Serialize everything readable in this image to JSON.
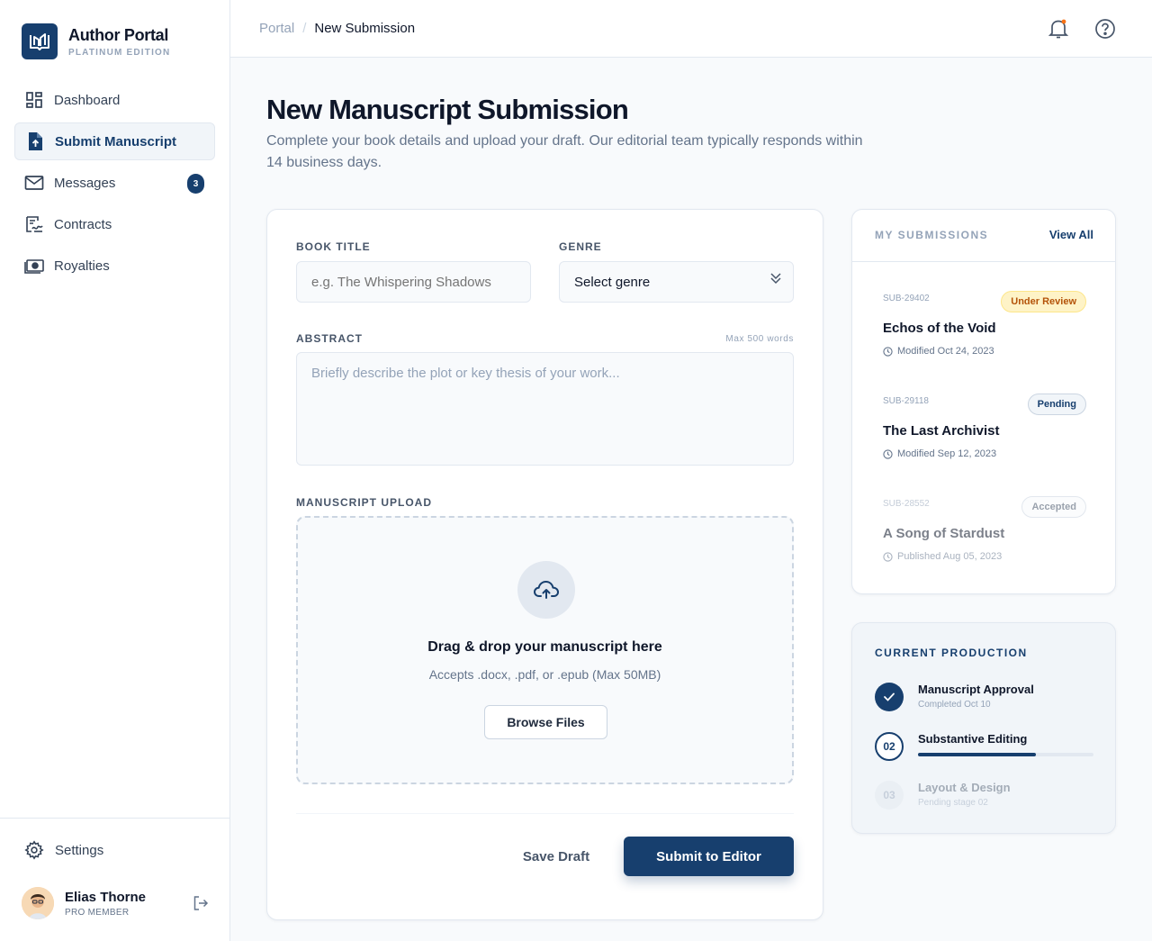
{
  "brand": {
    "title": "Author Portal",
    "subtitle": "PLATINUM EDITION",
    "icon": "open-book-icon"
  },
  "nav": {
    "items": [
      {
        "label": "Dashboard",
        "icon": "grid-icon"
      },
      {
        "label": "Submit Manuscript",
        "icon": "file-upload-icon",
        "active": true
      },
      {
        "label": "Messages",
        "icon": "mail-icon",
        "badge": "3"
      },
      {
        "label": "Contracts",
        "icon": "signature-icon"
      },
      {
        "label": "Royalties",
        "icon": "money-icon"
      }
    ]
  },
  "settings": {
    "label": "Settings",
    "icon": "gear-icon"
  },
  "user": {
    "name": "Elias Thorne",
    "role": "PRO MEMBER"
  },
  "breadcrumb": {
    "root": "Portal",
    "separator": "/",
    "current": "New Submission"
  },
  "header": {
    "title": "New Manuscript Submission",
    "description": "Complete your book details and upload your draft. Our editorial team typically responds within 14 business days."
  },
  "form": {
    "book_title_label": "BOOK TITLE",
    "book_title_placeholder": "e.g. The Whispering Shadows",
    "genre_label": "GENRE",
    "genre_value": "Select genre",
    "abstract_label": "ABSTRACT",
    "abstract_hint": "Max 500 words",
    "abstract_placeholder": "Briefly describe the plot or key thesis of your work...",
    "upload_label": "MANUSCRIPT UPLOAD",
    "upload_title": "Drag & drop your manuscript here",
    "upload_sub": "Accepts .docx, .pdf, or .epub (Max 50MB)",
    "browse_label": "Browse Files",
    "save_draft_label": "Save Draft",
    "submit_label": "Submit to Editor"
  },
  "submissions": {
    "title": "MY SUBMISSIONS",
    "view_all": "View All",
    "items": [
      {
        "id": "SUB-29402",
        "name": "Echos of the Void",
        "meta": "Modified Oct 24, 2023",
        "status": "Under Review",
        "status_color": "#b45309",
        "status_bg": "#fef3c7",
        "status_border": "#fde68a"
      },
      {
        "id": "SUB-29118",
        "name": "The Last Archivist",
        "meta": "Modified Sep 12, 2023",
        "status": "Pending",
        "status_color": "#173f6e",
        "status_bg": "#f1f5f9",
        "status_border": "#cbd5e1"
      },
      {
        "id": "SUB-28552",
        "name": "A Song of Stardust",
        "meta": "Published Aug 05, 2023",
        "status": "Accepted",
        "status_color": "#475569",
        "status_bg": "#f8fafc",
        "status_border": "#cbd5e1"
      }
    ]
  },
  "production": {
    "title": "CURRENT PRODUCTION",
    "steps": [
      {
        "number": "",
        "name": "Manuscript Approval",
        "sub": "Completed Oct 10",
        "state": "done"
      },
      {
        "number": "02",
        "name": "Substantive Editing",
        "sub": "",
        "state": "current",
        "progress": 0.67
      },
      {
        "number": "03",
        "name": "Layout & Design",
        "sub": "Pending stage 02",
        "state": "upcoming"
      }
    ]
  },
  "colors": {
    "primary": "#173f6e",
    "notification_dot": "#f97316"
  }
}
